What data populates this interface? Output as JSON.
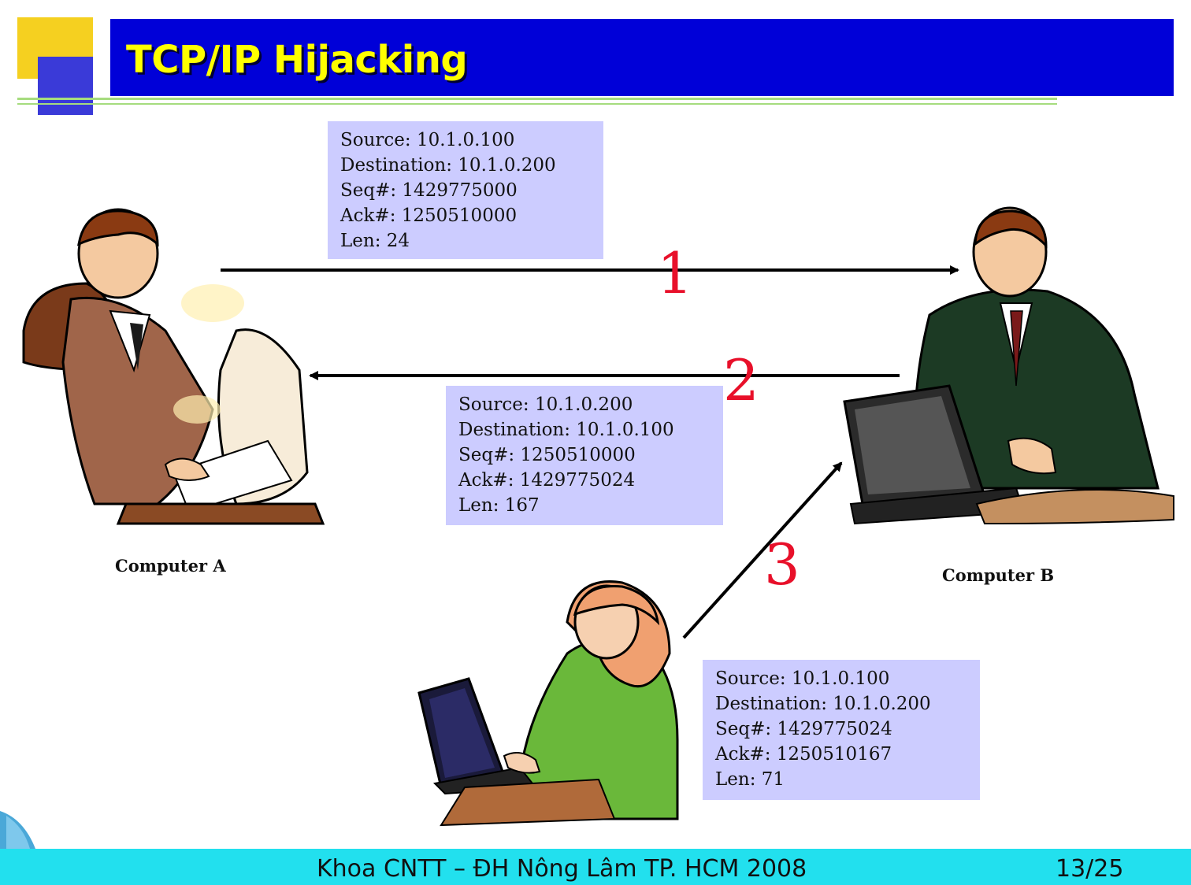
{
  "header": {
    "title": "TCP/IP Hijacking"
  },
  "packets": [
    {
      "source": "Source: 10.1.0.100",
      "destination": "Destination: 10.1.0.200",
      "seq": "Seq#: 1429775000",
      "ack": "Ack#: 1250510000",
      "len": "Len: 24"
    },
    {
      "source": "Source: 10.1.0.200",
      "destination": "Destination: 10.1.0.100",
      "seq": "Seq#: 1250510000",
      "ack": "Ack#: 1429775024",
      "len": "Len: 167"
    },
    {
      "source": "Source: 10.1.0.100",
      "destination": "Destination: 10.1.0.200",
      "seq": "Seq#: 1429775024",
      "ack": "Ack#: 1250510167",
      "len": "Len: 71"
    }
  ],
  "steps": [
    "1",
    "2",
    "3"
  ],
  "labels": {
    "computer_a": "Computer A",
    "computer_b": "Computer B"
  },
  "footer": {
    "text": "Khoa CNTT – ĐH Nông Lâm TP. HCM 2008",
    "page": "13/25"
  },
  "colors": {
    "header_bg": "#0000d8",
    "title": "#ffff00",
    "packet_bg": "#ccccff",
    "step_numbers": "#e8102a",
    "footer_bg": "#22e0ee"
  },
  "icons": [
    "businessman-computer-icon",
    "businessman-laptop-icon",
    "woman-laptop-icon"
  ]
}
